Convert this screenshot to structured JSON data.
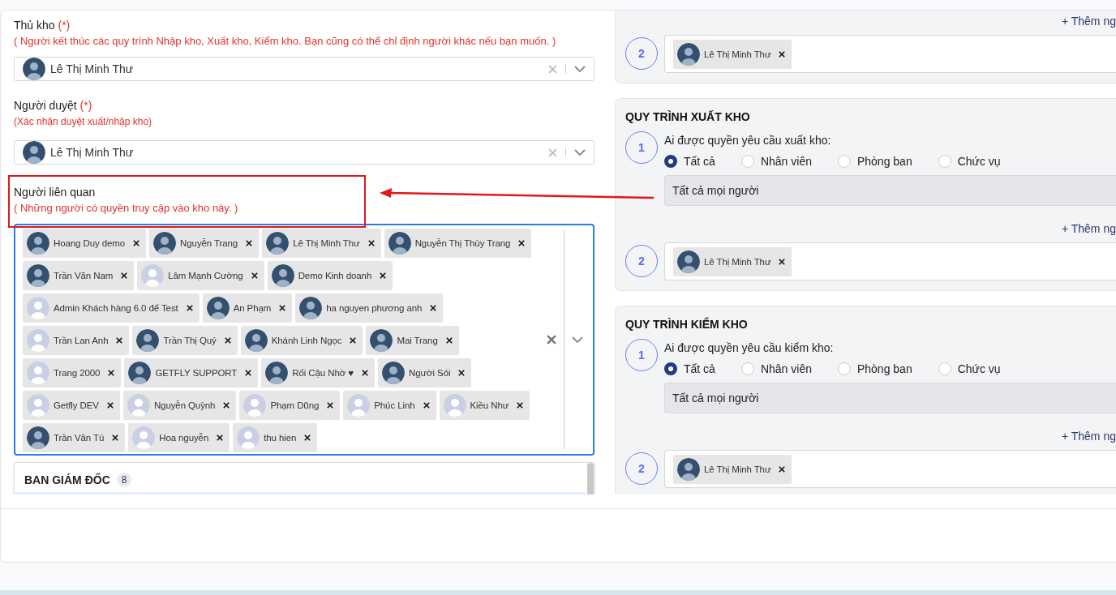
{
  "fields": [
    {
      "label": "Thủ kho",
      "required_mark": "(*)",
      "hint": "( Người kết thúc các quy trình Nhập kho, Xuất kho, Kiểm kho. Bạn cũng có thể chỉ định người khác nếu bạn muốn. )",
      "value": {
        "name": "Lê Thị Minh Thư",
        "kind": "photo"
      }
    },
    {
      "label": "Người duyệt",
      "required_mark": "(*)",
      "hint": "(Xác nhận duyệt xuất/nhập kho)",
      "value": {
        "name": "Lê Thị Minh Thư",
        "kind": "photo"
      }
    }
  ],
  "related": {
    "label": "Người liên quan",
    "hint": "( Những người có quyền truy cập vào kho này. )",
    "focused": true,
    "people": [
      {
        "name": "Hoang Duy demo",
        "kind": "photo"
      },
      {
        "name": "Nguyễn Trang",
        "kind": "photo"
      },
      {
        "name": "Lê Thị Minh Thư",
        "kind": "photo"
      },
      {
        "name": "Nguyễn Thị Thùy Trang",
        "kind": "photo"
      },
      {
        "name": "Trần Văn Nam",
        "kind": "photo"
      },
      {
        "name": "Lâm Mạnh Cường",
        "kind": "default"
      },
      {
        "name": "Demo Kinh doanh",
        "kind": "photo"
      },
      {
        "name": "Admin Khách hàng 6.0 để Test",
        "kind": "default"
      },
      {
        "name": "An Phạm",
        "kind": "photo"
      },
      {
        "name": "ha nguyen phương anh",
        "kind": "photo"
      },
      {
        "name": "Trần Lan Anh",
        "kind": "default"
      },
      {
        "name": "Trần Thị Quý",
        "kind": "photo"
      },
      {
        "name": "Khánh Linh Ngọc",
        "kind": "photo"
      },
      {
        "name": "Mai Trang",
        "kind": "photo"
      },
      {
        "name": "Trang 2000",
        "kind": "default"
      },
      {
        "name": "GETFLY SUPPORT",
        "kind": "photo"
      },
      {
        "name": "Rối Cậu Nhờ ♥",
        "kind": "photo"
      },
      {
        "name": "Người Sói",
        "kind": "photo"
      },
      {
        "name": "Getfly DEV",
        "kind": "default"
      },
      {
        "name": "Nguyễn Quỳnh",
        "kind": "default"
      },
      {
        "name": "Phạm Dũng",
        "kind": "default"
      },
      {
        "name": "Phúc Linh",
        "kind": "default"
      },
      {
        "name": "Kiều Như",
        "kind": "default"
      },
      {
        "name": "Trần Văn Tú",
        "kind": "photo"
      },
      {
        "name": "Hoa nguyễn",
        "kind": "default"
      },
      {
        "name": "thu hien",
        "kind": "default"
      }
    ],
    "dropdown": {
      "group": "BAN GIÁM ĐỐC",
      "count": "8"
    }
  },
  "annotation": {
    "highlight_box": true,
    "arrow": true
  },
  "processes": [
    {
      "top_cut": true,
      "items": [
        {
          "kind": "add",
          "label": "+ Thêm ng"
        },
        {
          "kind": "people",
          "number": "2",
          "people": [
            {
              "name": "Lê Thị Minh Thư",
              "kind": "photo"
            }
          ]
        }
      ]
    },
    {
      "title": "QUY TRÌNH XUẤT KHO",
      "items": [
        {
          "kind": "choice",
          "number": "1",
          "question": "Ai được quyền yêu cầu xuất kho:",
          "options": [
            {
              "label": "Tất cả",
              "selected": true
            },
            {
              "label": "Nhân viên",
              "selected": false
            },
            {
              "label": "Phòng ban",
              "selected": false
            },
            {
              "label": "Chức vụ",
              "selected": false
            }
          ],
          "value": "Tất cả mọi người"
        },
        {
          "kind": "add",
          "label": "+ Thêm ng"
        },
        {
          "kind": "people",
          "number": "2",
          "people": [
            {
              "name": "Lê Thị Minh Thư",
              "kind": "photo"
            }
          ]
        }
      ]
    },
    {
      "title": "QUY TRÌNH KIỂM KHO",
      "items": [
        {
          "kind": "choice",
          "number": "1",
          "question": "Ai được quyền yêu cầu kiểm kho:",
          "options": [
            {
              "label": "Tất cả",
              "selected": true
            },
            {
              "label": "Nhân viên",
              "selected": false
            },
            {
              "label": "Phòng ban",
              "selected": false
            },
            {
              "label": "Chức vụ",
              "selected": false
            }
          ],
          "value": "Tất cả mọi người"
        },
        {
          "kind": "add",
          "label": "+ Thêm ng"
        },
        {
          "kind": "people",
          "number": "2",
          "people": [
            {
              "name": "Lê Thị Minh Thư",
              "kind": "photo"
            }
          ]
        }
      ]
    }
  ]
}
